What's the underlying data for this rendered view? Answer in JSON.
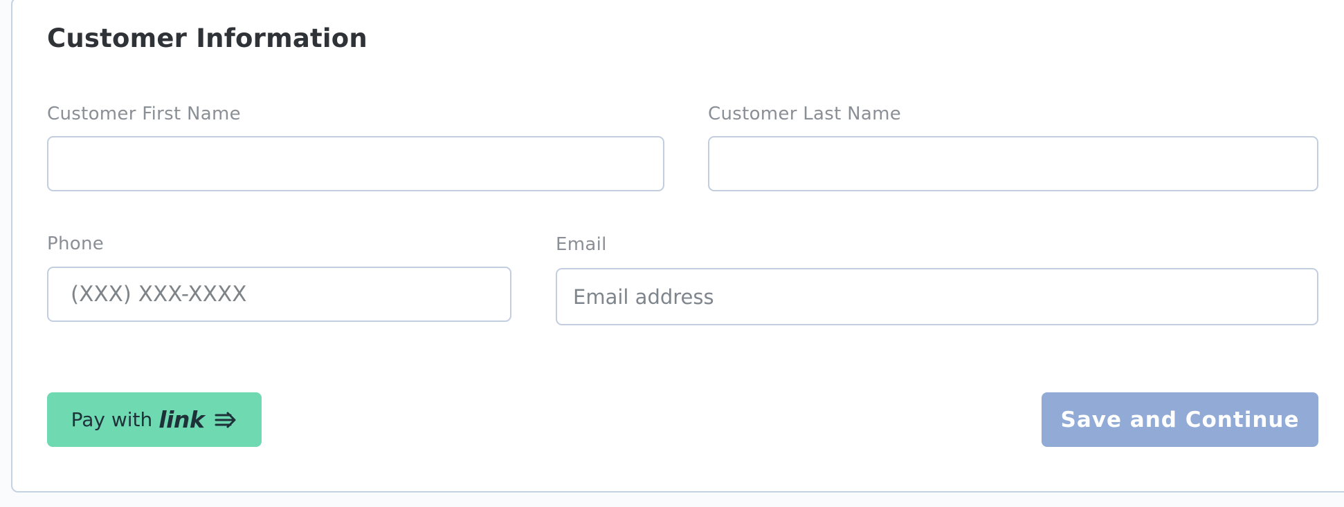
{
  "form": {
    "title": "Customer Information",
    "first_name": {
      "label": "Customer First Name",
      "value": "",
      "placeholder": ""
    },
    "last_name": {
      "label": "Customer Last Name",
      "value": "",
      "placeholder": ""
    },
    "phone": {
      "label": "Phone",
      "value": "",
      "placeholder": "(XXX) XXX-XXXX"
    },
    "email": {
      "label": "Email",
      "value": "",
      "placeholder": "Email address"
    }
  },
  "actions": {
    "pay_with_prefix": "Pay with",
    "pay_with_brand": "link",
    "save_label": "Save and Continue"
  },
  "colors": {
    "link_button": "#6fd9b2",
    "save_button": "#91aad6",
    "border": "#c2cde0"
  },
  "icons": {
    "link_arrow": "arrow-right-icon"
  }
}
